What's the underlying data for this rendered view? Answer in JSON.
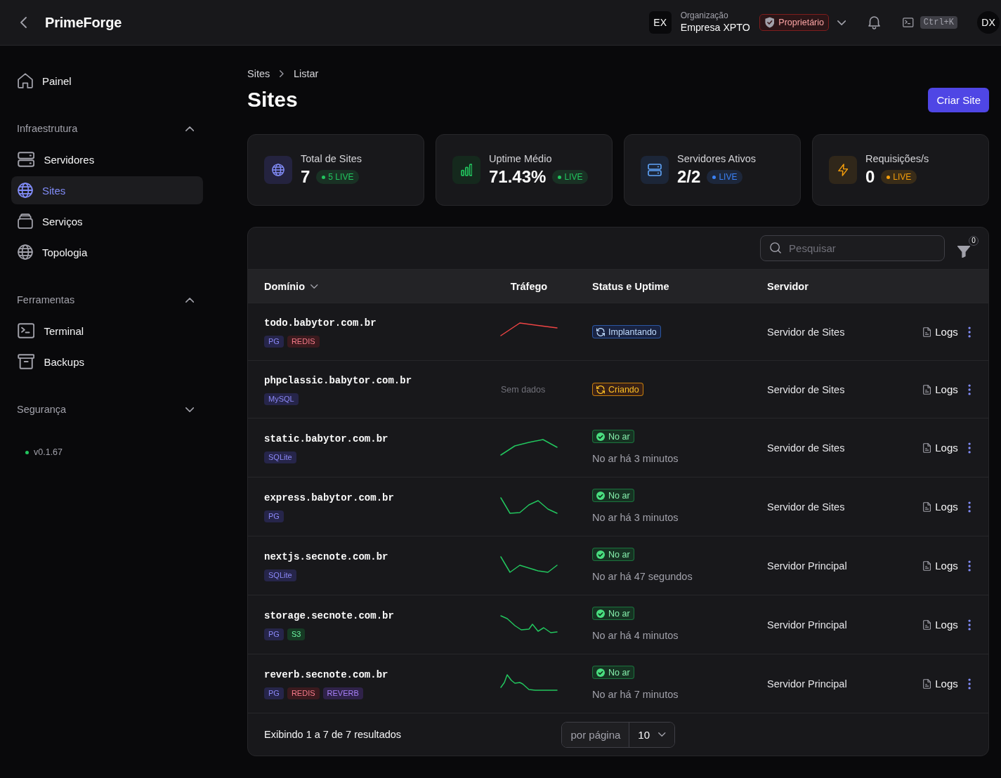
{
  "topbar": {
    "brand": "PrimeForge",
    "org": {
      "initials": "EX",
      "label": "Organização",
      "name": "Empresa XPTO",
      "role": "Proprietário"
    },
    "shortcut": "Ctrl+K",
    "avatar": "DX"
  },
  "sidebar": {
    "items": [
      {
        "label": "Painel",
        "kind": "home",
        "selected": false
      }
    ],
    "sections": [
      {
        "title": "Infraestrutura",
        "expanded": true,
        "items": [
          {
            "label": "Servidores",
            "kind": "servers",
            "selected": false
          },
          {
            "label": "Sites",
            "kind": "sites",
            "selected": true
          },
          {
            "label": "Serviços",
            "kind": "services",
            "selected": false
          },
          {
            "label": "Topologia",
            "kind": "topology",
            "selected": false
          }
        ]
      },
      {
        "title": "Ferramentas",
        "expanded": true,
        "items": [
          {
            "label": "Terminal",
            "kind": "terminal",
            "selected": false
          },
          {
            "label": "Backups",
            "kind": "backups",
            "selected": false
          }
        ]
      },
      {
        "title": "Segurança",
        "expanded": false
      }
    ],
    "version": "v0.1.67"
  },
  "breadcrumb": [
    "Sites",
    "Listar"
  ],
  "page": {
    "title": "Sites",
    "action": "Criar Site"
  },
  "stats": [
    {
      "kind": "sites",
      "label": "Total de Sites",
      "value": "7",
      "badge": "5 LIVE",
      "color": "#22c55e"
    },
    {
      "kind": "uptime",
      "label": "Uptime Médio",
      "value": "71.43%",
      "badge": "LIVE",
      "color": "#22c55e"
    },
    {
      "kind": "servers",
      "label": "Servidores Ativos",
      "value": "2/2",
      "badge": "LIVE",
      "color": "#3b82f6"
    },
    {
      "kind": "requests",
      "label": "Requisições/s",
      "value": "0",
      "badge": "LIVE",
      "color": "#f59e0b"
    }
  ],
  "table": {
    "search": {
      "placeholder": "Pesquisar"
    },
    "filter_count": "0",
    "columns": [
      {
        "label": "Domínio",
        "sorted": true
      },
      {
        "label": "Tráfego",
        "sorted": false
      },
      {
        "label": "Status e Uptime",
        "sorted": false
      },
      {
        "label": "Servidor",
        "sorted": false
      }
    ],
    "rows": [
      {
        "domain": "todo.babytor.com.br",
        "tags": [
          {
            "label": "PG",
            "color": "#26254a"
          },
          {
            "label": "REDIS",
            "color": "#3b1a1e"
          }
        ],
        "traffic": {
          "kind": "sparkline",
          "color": "#ef4444"
        },
        "status": {
          "kind": "deploying",
          "label": "Implantando"
        },
        "server": "Servidor de Sites",
        "action": "Logs"
      },
      {
        "domain": "phpclassic.babytor.com.br",
        "tags": [
          {
            "label": "MySQL",
            "color": "#26254a"
          }
        ],
        "traffic": {
          "kind": "none",
          "text": "Sem dados"
        },
        "status": {
          "kind": "creating",
          "label": "Criando"
        },
        "server": "Servidor de Sites",
        "action": "Logs"
      },
      {
        "domain": "static.babytor.com.br",
        "tags": [
          {
            "label": "SQLite",
            "color": "#26254a"
          }
        ],
        "traffic": {
          "kind": "sparkline",
          "color": "#22c55e"
        },
        "status": {
          "kind": "online",
          "label": "No ar"
        },
        "uptime": "No ar há 3 minutos",
        "server": "Servidor de Sites",
        "action": "Logs"
      },
      {
        "domain": "express.babytor.com.br",
        "tags": [
          {
            "label": "PG",
            "color": "#26254a"
          }
        ],
        "traffic": {
          "kind": "sparkline",
          "color": "#22c55e"
        },
        "status": {
          "kind": "online",
          "label": "No ar"
        },
        "uptime": "No ar há 3 minutos",
        "server": "Servidor de Sites",
        "action": "Logs"
      },
      {
        "domain": "nextjs.secnote.com.br",
        "tags": [
          {
            "label": "SQLite",
            "color": "#26254a"
          }
        ],
        "traffic": {
          "kind": "sparkline",
          "color": "#22c55e"
        },
        "status": {
          "kind": "online",
          "label": "No ar"
        },
        "uptime": "No ar há 47 segundos",
        "server": "Servidor Principal",
        "action": "Logs"
      },
      {
        "domain": "storage.secnote.com.br",
        "tags": [
          {
            "label": "PG",
            "color": "#26254a"
          },
          {
            "label": "S3",
            "color": "#163a24"
          }
        ],
        "traffic": {
          "kind": "sparkline",
          "color": "#22c55e"
        },
        "status": {
          "kind": "online",
          "label": "No ar"
        },
        "uptime": "No ar há 4 minutos",
        "server": "Servidor Principal",
        "action": "Logs"
      },
      {
        "domain": "reverb.secnote.com.br",
        "tags": [
          {
            "label": "PG",
            "color": "#26254a"
          },
          {
            "label": "REDIS",
            "color": "#3b1a1e"
          },
          {
            "label": "REVERB",
            "color": "#2f2249"
          }
        ],
        "traffic": {
          "kind": "sparkline",
          "color": "#22c55e"
        },
        "status": {
          "kind": "online",
          "label": "No ar"
        },
        "uptime": "No ar há 7 minutos",
        "server": "Servidor Principal",
        "action": "Logs"
      }
    ],
    "footer": {
      "summary": "Exibindo 1 a 7 de 7 resultados",
      "per_page_label": "por página",
      "per_page": "10"
    }
  }
}
